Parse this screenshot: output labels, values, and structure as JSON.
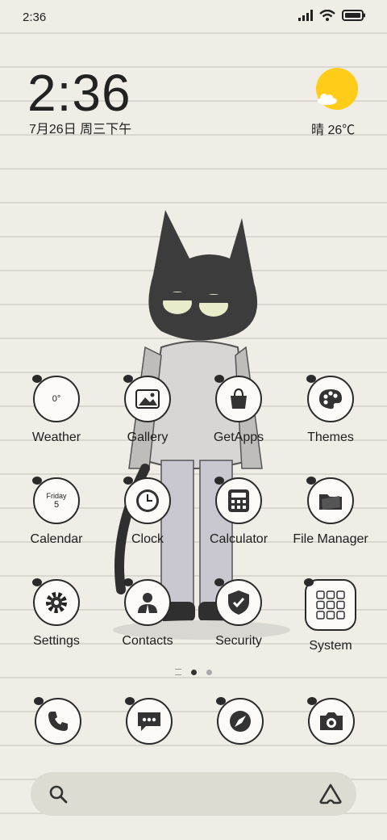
{
  "status_bar": {
    "time": "2:36"
  },
  "lock_widget": {
    "time": "2:36",
    "date": "7月26日 周三下午",
    "weather": "晴 26℃"
  },
  "apps": [
    {
      "id": "weather",
      "label": "Weather",
      "icon": "weather-icon",
      "inner": "0°"
    },
    {
      "id": "gallery",
      "label": "Gallery",
      "icon": "gallery-icon"
    },
    {
      "id": "getapps",
      "label": "GetApps",
      "icon": "shopping-bag-icon"
    },
    {
      "id": "themes",
      "label": "Themes",
      "icon": "palette-icon"
    },
    {
      "id": "calendar",
      "label": "Calendar",
      "icon": "calendar-icon",
      "inner_day": "Friday",
      "inner_date": "5"
    },
    {
      "id": "clock",
      "label": "Clock",
      "icon": "clock-icon"
    },
    {
      "id": "calculator",
      "label": "Calculator",
      "icon": "calculator-icon"
    },
    {
      "id": "filemanager",
      "label": "File Manager",
      "icon": "folder-icon"
    },
    {
      "id": "settings",
      "label": "Settings",
      "icon": "gear-icon"
    },
    {
      "id": "contacts",
      "label": "Contacts",
      "icon": "person-icon"
    },
    {
      "id": "security",
      "label": "Security",
      "icon": "shield-icon"
    },
    {
      "id": "system",
      "label": "System",
      "icon": "app-grid-icon"
    }
  ],
  "dock": [
    {
      "id": "phone",
      "icon": "phone-icon"
    },
    {
      "id": "messages",
      "icon": "message-icon"
    },
    {
      "id": "browser",
      "icon": "compass-icon"
    },
    {
      "id": "camera",
      "icon": "camera-icon"
    }
  ],
  "page_indicator": {
    "pages": 2,
    "current": 1
  },
  "search_bar": {
    "left_icon": "search-icon",
    "right_icon": "assistant-icon"
  },
  "colors": {
    "background": "#efede6",
    "sun": "#ffcc1a",
    "ink": "#2a2a2a"
  }
}
